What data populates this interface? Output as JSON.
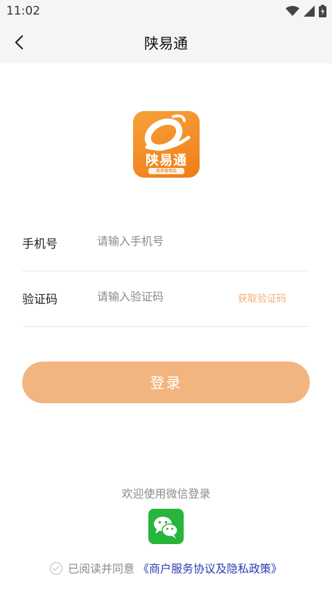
{
  "status_bar": {
    "time": "11:02"
  },
  "nav": {
    "title": "陕易通"
  },
  "logo": {
    "text": "陕易通",
    "subtext": "商务管理会"
  },
  "form": {
    "phone": {
      "label": "手机号",
      "placeholder": "请输入手机号",
      "value": ""
    },
    "code": {
      "label": "验证码",
      "placeholder": "请输入验证码",
      "value": "",
      "get_code": "获取验证码"
    }
  },
  "login_button": "登录",
  "wechat": {
    "caption": "欢迎使用微信登录",
    "icon": "wechat-icon"
  },
  "agreement": {
    "prefix": "已阅读并同意",
    "link": "《商户服务协议及隐私政策》"
  },
  "colors": {
    "accent": "#f3b580",
    "logo_orange": "#f08a22",
    "link": "#2a3bb0",
    "wechat_green": "#27b53b"
  }
}
